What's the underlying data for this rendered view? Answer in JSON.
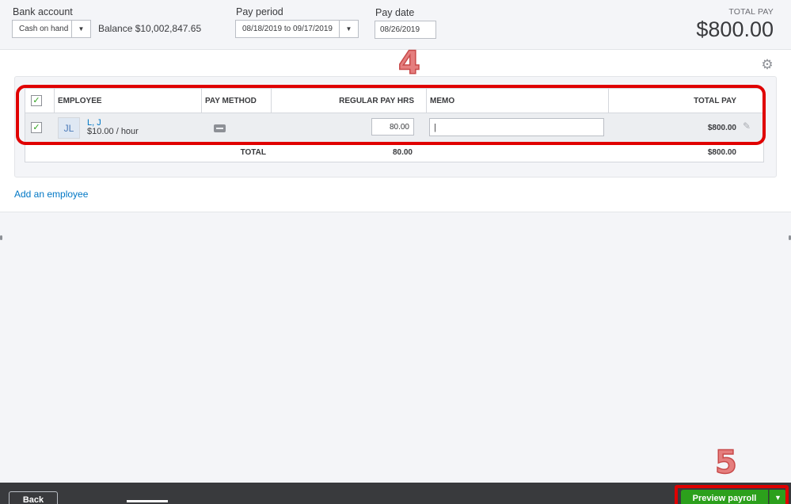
{
  "header": {
    "bank_account_label": "Bank account",
    "bank_account_value": "Cash on hand",
    "balance_text": "Balance $10,002,847.65",
    "pay_period_label": "Pay period",
    "pay_period_value": "08/18/2019 to 09/17/2019",
    "pay_date_label": "Pay date",
    "pay_date_value": "08/26/2019",
    "total_pay_label": "TOTAL PAY",
    "total_pay_amount": "$800.00"
  },
  "table": {
    "columns": {
      "employee": "EMPLOYEE",
      "pay_method": "PAY METHOD",
      "regular_pay_hrs": "REGULAR PAY HRS",
      "memo": "MEMO",
      "total_pay": "TOTAL PAY"
    },
    "rows": [
      {
        "initials": "JL",
        "name": "L, J",
        "rate": "$10.00 / hour",
        "regular_hrs": "80.00",
        "memo": "|",
        "total_pay": "$800.00"
      }
    ],
    "totals": {
      "label": "TOTAL",
      "hrs": "80.00",
      "pay": "$800.00"
    }
  },
  "add_employee_label": "Add an employee",
  "annotations": {
    "step_4": "4",
    "step_5": "5"
  },
  "footer": {
    "back_label": "Back",
    "preview_label": "Preview payroll",
    "split_arrow": "▼"
  },
  "icons": {
    "dropdown": "▼",
    "check": "✓",
    "gear": "⚙",
    "pencil": "✎"
  },
  "colors": {
    "primary_green": "#2ca01c",
    "link_blue": "#0077c5",
    "annotation_red": "#e00000",
    "footer_bg": "#393a3d"
  }
}
